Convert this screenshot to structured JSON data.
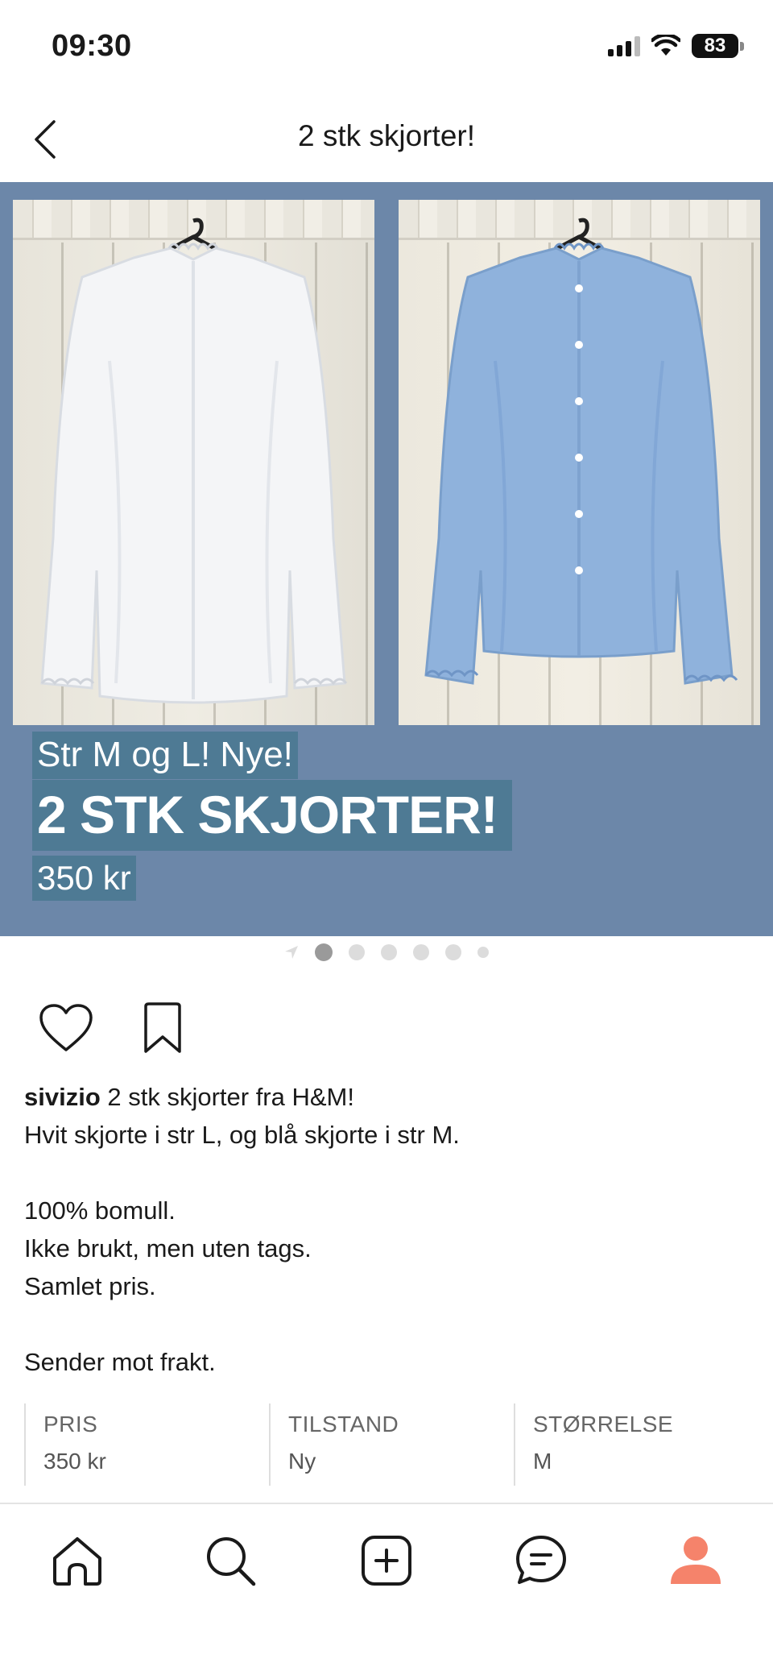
{
  "status_bar": {
    "time": "09:30",
    "battery": "83",
    "icons": [
      "signal-icon",
      "wifi-icon",
      "battery-icon"
    ]
  },
  "header": {
    "title": "2 stk skjorter!",
    "back_icon": "chevron-left-icon"
  },
  "hero": {
    "background_color": "#6c87a9",
    "overlay_color": "#4e7a94",
    "subtitle": "Str M og L! Nye!",
    "title": "2 STK SKJORTER!",
    "price": "350 kr",
    "images": [
      {
        "name": "white-shirt-photo",
        "shirt_color": "#f4f5f7"
      },
      {
        "name": "blue-shirt-photo",
        "shirt_color": "#8fb2dc"
      }
    ]
  },
  "carousel": {
    "total_dots": 6,
    "active_index": 0
  },
  "actions": {
    "icons": [
      "heart-icon",
      "bookmark-icon"
    ]
  },
  "description": {
    "username": "sivizio",
    "first_line": " 2 stk skjorter  fra H&M!",
    "lines": [
      "Hvit skjorte i str L, og blå skjorte i str M.",
      "",
      "100% bomull.",
      "Ikke brukt, men uten tags.",
      "Samlet pris.",
      "",
      "Sender mot frakt."
    ]
  },
  "info": [
    {
      "label": "PRIS",
      "value": "350 kr"
    },
    {
      "label": "TILSTAND",
      "value": "Ny"
    },
    {
      "label": "STØRRELSE",
      "value": "M"
    }
  ],
  "bottom_nav": {
    "items": [
      "home-icon",
      "search-icon",
      "add-icon",
      "messages-icon",
      "profile-icon"
    ],
    "profile_color": "#f5836b"
  }
}
